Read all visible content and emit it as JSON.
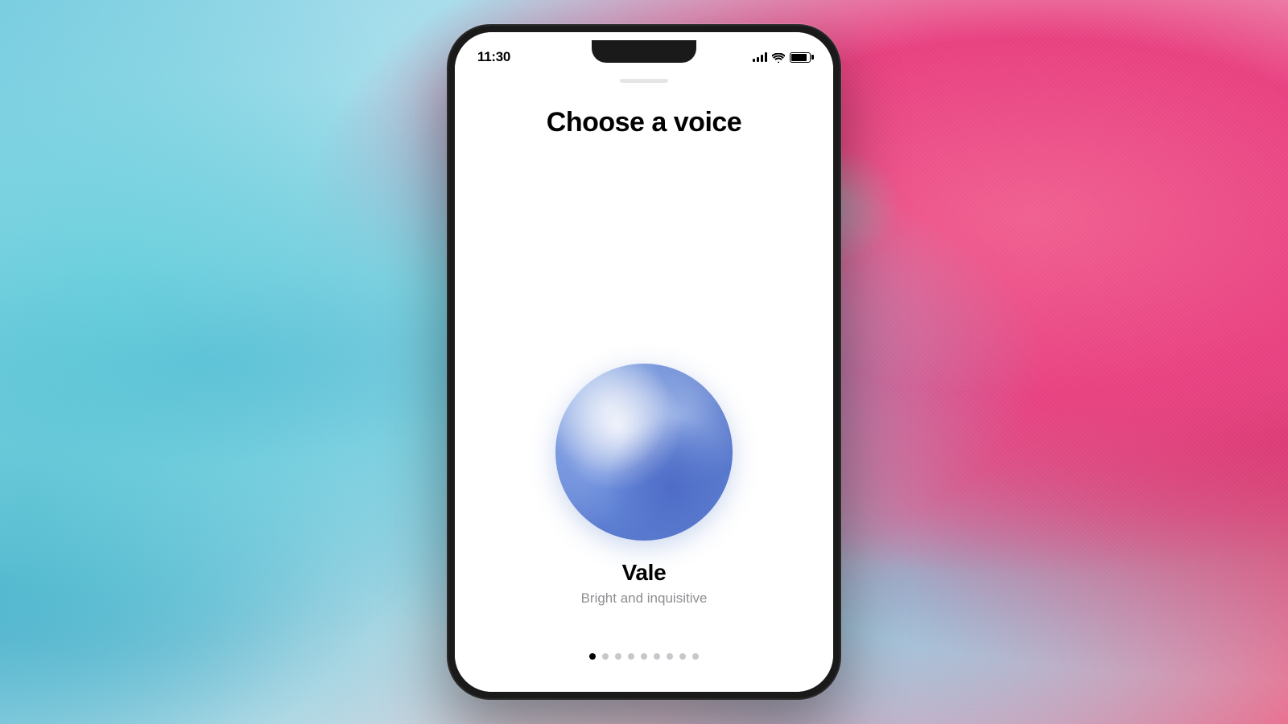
{
  "background": {
    "colors": {
      "teal_left": "#5bb8d4",
      "pink_right": "#e84080",
      "overlay": "rgba(255,255,255,0.03)"
    }
  },
  "status_bar": {
    "time": "11:30",
    "signal_label": "signal",
    "wifi_label": "wifi",
    "battery_label": "battery"
  },
  "screen": {
    "title": "Choose a voice",
    "voice": {
      "name": "Vale",
      "description": "Bright and inquisitive",
      "avatar_alt": "blue gradient sphere representing Vale voice"
    },
    "pagination": {
      "total_dots": 9,
      "active_dot_index": 0
    }
  }
}
